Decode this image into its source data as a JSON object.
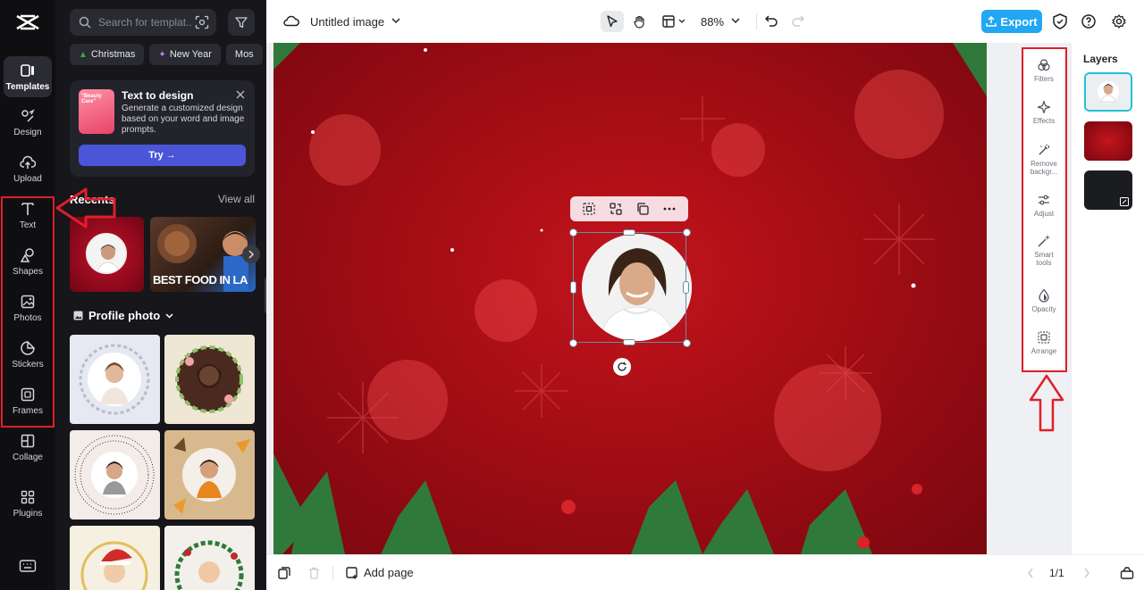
{
  "rail": {
    "items": [
      {
        "label": "Templates"
      },
      {
        "label": "Design"
      },
      {
        "label": "Upload"
      },
      {
        "label": "Text"
      },
      {
        "label": "Shapes"
      },
      {
        "label": "Photos"
      },
      {
        "label": "Stickers"
      },
      {
        "label": "Frames"
      },
      {
        "label": "Collage"
      },
      {
        "label": "Plugins"
      }
    ]
  },
  "panel": {
    "search_placeholder": "Search for templat...",
    "chips": [
      "Christmas",
      "New Year",
      "Mos"
    ],
    "promo": {
      "thumb_text": "\"Beauty Care\"",
      "title": "Text to design",
      "description": "Generate a customized design based on your word and image prompts.",
      "try_label": "Try →"
    },
    "recents_title": "Recents",
    "view_all": "View all",
    "recent_text": "BEST FOOD IN LA",
    "profile_section": "Profile photo"
  },
  "topbar": {
    "doc_title": "Untitled image",
    "zoom": "88%",
    "export_label": "Export"
  },
  "tools_strip": {
    "items": [
      {
        "label": "Filters"
      },
      {
        "label": "Effects"
      },
      {
        "label": "Remove backgr..."
      },
      {
        "label": "Adjust"
      },
      {
        "label": "Smart tools"
      },
      {
        "label": "Opacity"
      },
      {
        "label": "Arrange"
      }
    ]
  },
  "layers": {
    "title": "Layers"
  },
  "bottombar": {
    "add_page": "Add page",
    "page_indicator": "1/1"
  },
  "colors": {
    "accent": "#21a7f3",
    "annotation": "#e01f2a",
    "canvas_red": "#b5101a",
    "try_button": "#4a55d8"
  }
}
